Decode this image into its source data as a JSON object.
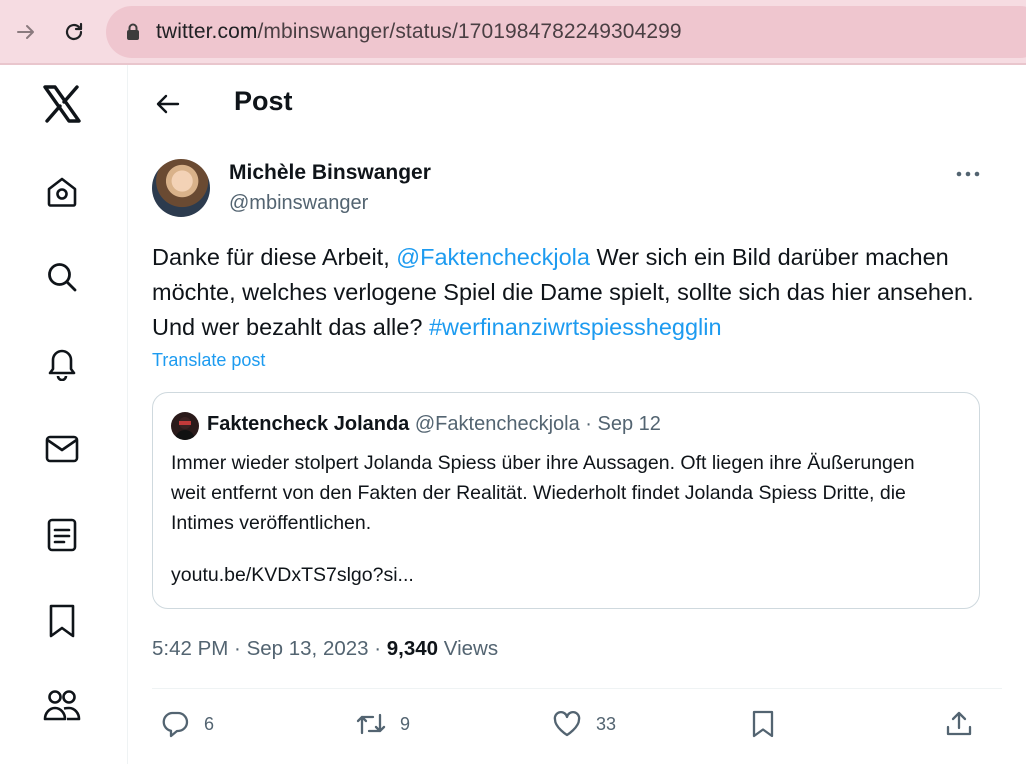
{
  "browser": {
    "url_host": "twitter.com",
    "url_path": "/mbinswanger/status/1701984782249304299"
  },
  "leftnav": {
    "icons": [
      "x-logo-icon",
      "home-icon",
      "search-icon",
      "notifications-icon",
      "messages-icon",
      "lists-icon",
      "bookmarks-icon",
      "communities-icon"
    ]
  },
  "header": {
    "title": "Post"
  },
  "author": {
    "name": "Michèle Binswanger",
    "handle": "@mbinswanger"
  },
  "tweet": {
    "text_1": "Danke für diese Arbeit, ",
    "mention": "@Faktencheckjola",
    "text_2": " Wer sich ein Bild darüber machen möchte, welches verlogene Spiel die Dame spielt, sollte sich das hier ansehen. Und wer bezahlt das alle? ",
    "hashtag": "#werfinanziwrtspiesshegglin",
    "translate_label": "Translate post"
  },
  "quote": {
    "name": "Faktencheck Jolanda",
    "handle": "@Faktencheckjola",
    "date": "Sep 12",
    "text": "Immer wieder stolpert Jolanda Spiess über ihre Aussagen. Oft liegen ihre Äußerungen weit entfernt von den Fakten der Realität. Wiederholt findet Jolanda Spiess Dritte, die Intimes veröffentlichen.",
    "url": "youtu.be/KVDxTS7slgo?si..."
  },
  "meta": {
    "time": "5:42 PM",
    "date": "Sep 13, 2023",
    "views_count": "9,340",
    "views_label": "Views"
  },
  "actions": {
    "replies": "6",
    "reposts": "9",
    "likes": "33"
  },
  "colors": {
    "accent": "#1d9bf0",
    "muted_text": "#536471",
    "browser_bar": "#f6dce2"
  }
}
